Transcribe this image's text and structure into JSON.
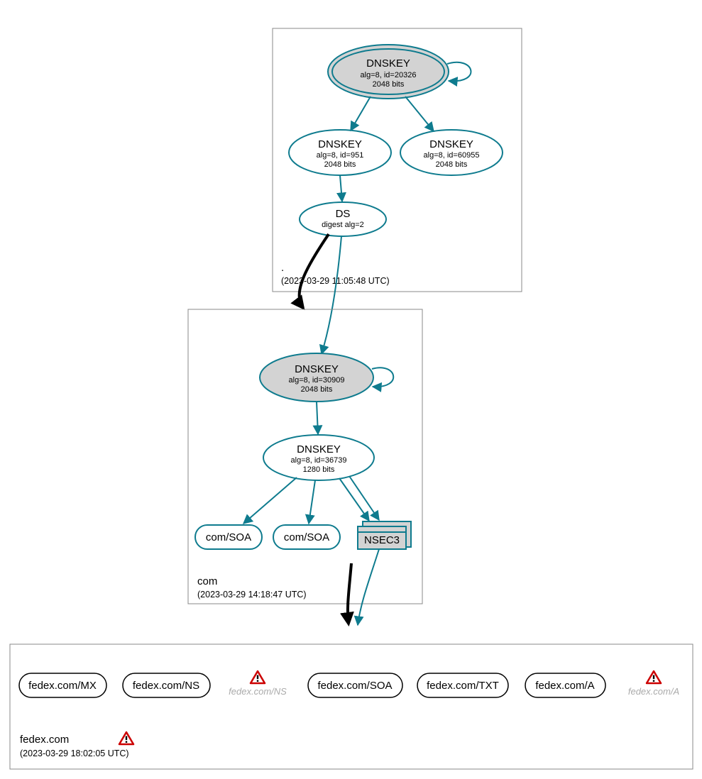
{
  "zones": {
    "root": {
      "label": ".",
      "timestamp": "(2023-03-29 11:05:48 UTC)"
    },
    "com": {
      "label": "com",
      "timestamp": "(2023-03-29 14:18:47 UTC)"
    },
    "fedex": {
      "label": "fedex.com",
      "timestamp": "(2023-03-29 18:02:05 UTC)"
    }
  },
  "nodes": {
    "root_ksk": {
      "title": "DNSKEY",
      "sub1": "alg=8, id=20326",
      "sub2": "2048 bits"
    },
    "root_zsk1": {
      "title": "DNSKEY",
      "sub1": "alg=8, id=951",
      "sub2": "2048 bits"
    },
    "root_zsk2": {
      "title": "DNSKEY",
      "sub1": "alg=8, id=60955",
      "sub2": "2048 bits"
    },
    "root_ds": {
      "title": "DS",
      "sub1": "digest alg=2"
    },
    "com_ksk": {
      "title": "DNSKEY",
      "sub1": "alg=8, id=30909",
      "sub2": "2048 bits"
    },
    "com_zsk": {
      "title": "DNSKEY",
      "sub1": "alg=8, id=36739",
      "sub2": "1280 bits"
    },
    "com_soa1": {
      "label": "com/SOA"
    },
    "com_soa2": {
      "label": "com/SOA"
    },
    "com_nsec3": {
      "label": "NSEC3"
    }
  },
  "rrsets": {
    "mx": {
      "label": "fedex.com/MX"
    },
    "ns": {
      "label": "fedex.com/NS"
    },
    "ns_warn": {
      "label": "fedex.com/NS"
    },
    "soa": {
      "label": "fedex.com/SOA"
    },
    "txt": {
      "label": "fedex.com/TXT"
    },
    "a": {
      "label": "fedex.com/A"
    },
    "a_warn": {
      "label": "fedex.com/A"
    }
  }
}
